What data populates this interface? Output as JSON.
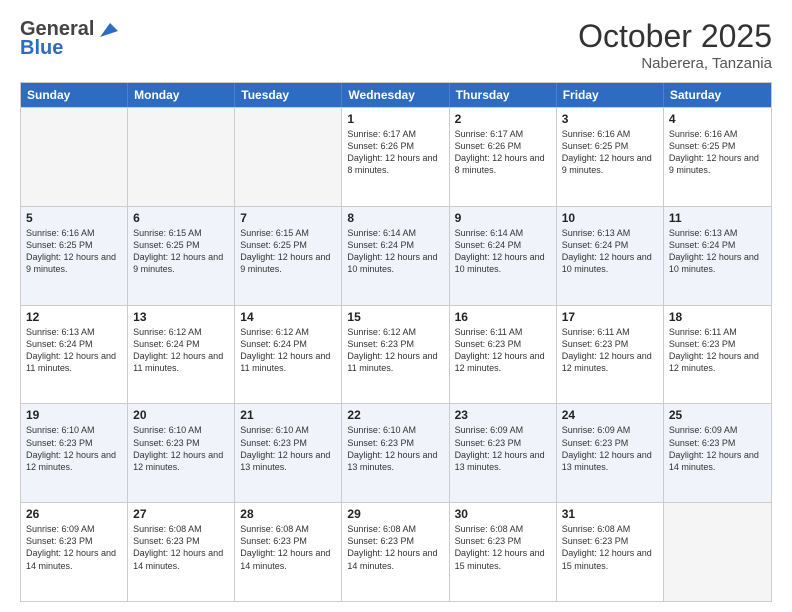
{
  "header": {
    "logo_general": "General",
    "logo_blue": "Blue",
    "month_title": "October 2025",
    "subtitle": "Naberera, Tanzania"
  },
  "days_of_week": [
    "Sunday",
    "Monday",
    "Tuesday",
    "Wednesday",
    "Thursday",
    "Friday",
    "Saturday"
  ],
  "rows": [
    [
      {
        "day": "",
        "sunrise": "",
        "sunset": "",
        "daylight": "",
        "empty": true
      },
      {
        "day": "",
        "sunrise": "",
        "sunset": "",
        "daylight": "",
        "empty": true
      },
      {
        "day": "",
        "sunrise": "",
        "sunset": "",
        "daylight": "",
        "empty": true
      },
      {
        "day": "1",
        "sunrise": "Sunrise: 6:17 AM",
        "sunset": "Sunset: 6:26 PM",
        "daylight": "Daylight: 12 hours and 8 minutes."
      },
      {
        "day": "2",
        "sunrise": "Sunrise: 6:17 AM",
        "sunset": "Sunset: 6:26 PM",
        "daylight": "Daylight: 12 hours and 8 minutes."
      },
      {
        "day": "3",
        "sunrise": "Sunrise: 6:16 AM",
        "sunset": "Sunset: 6:25 PM",
        "daylight": "Daylight: 12 hours and 9 minutes."
      },
      {
        "day": "4",
        "sunrise": "Sunrise: 6:16 AM",
        "sunset": "Sunset: 6:25 PM",
        "daylight": "Daylight: 12 hours and 9 minutes."
      }
    ],
    [
      {
        "day": "5",
        "sunrise": "Sunrise: 6:16 AM",
        "sunset": "Sunset: 6:25 PM",
        "daylight": "Daylight: 12 hours and 9 minutes."
      },
      {
        "day": "6",
        "sunrise": "Sunrise: 6:15 AM",
        "sunset": "Sunset: 6:25 PM",
        "daylight": "Daylight: 12 hours and 9 minutes."
      },
      {
        "day": "7",
        "sunrise": "Sunrise: 6:15 AM",
        "sunset": "Sunset: 6:25 PM",
        "daylight": "Daylight: 12 hours and 9 minutes."
      },
      {
        "day": "8",
        "sunrise": "Sunrise: 6:14 AM",
        "sunset": "Sunset: 6:24 PM",
        "daylight": "Daylight: 12 hours and 10 minutes."
      },
      {
        "day": "9",
        "sunrise": "Sunrise: 6:14 AM",
        "sunset": "Sunset: 6:24 PM",
        "daylight": "Daylight: 12 hours and 10 minutes."
      },
      {
        "day": "10",
        "sunrise": "Sunrise: 6:13 AM",
        "sunset": "Sunset: 6:24 PM",
        "daylight": "Daylight: 12 hours and 10 minutes."
      },
      {
        "day": "11",
        "sunrise": "Sunrise: 6:13 AM",
        "sunset": "Sunset: 6:24 PM",
        "daylight": "Daylight: 12 hours and 10 minutes."
      }
    ],
    [
      {
        "day": "12",
        "sunrise": "Sunrise: 6:13 AM",
        "sunset": "Sunset: 6:24 PM",
        "daylight": "Daylight: 12 hours and 11 minutes."
      },
      {
        "day": "13",
        "sunrise": "Sunrise: 6:12 AM",
        "sunset": "Sunset: 6:24 PM",
        "daylight": "Daylight: 12 hours and 11 minutes."
      },
      {
        "day": "14",
        "sunrise": "Sunrise: 6:12 AM",
        "sunset": "Sunset: 6:24 PM",
        "daylight": "Daylight: 12 hours and 11 minutes."
      },
      {
        "day": "15",
        "sunrise": "Sunrise: 6:12 AM",
        "sunset": "Sunset: 6:23 PM",
        "daylight": "Daylight: 12 hours and 11 minutes."
      },
      {
        "day": "16",
        "sunrise": "Sunrise: 6:11 AM",
        "sunset": "Sunset: 6:23 PM",
        "daylight": "Daylight: 12 hours and 12 minutes."
      },
      {
        "day": "17",
        "sunrise": "Sunrise: 6:11 AM",
        "sunset": "Sunset: 6:23 PM",
        "daylight": "Daylight: 12 hours and 12 minutes."
      },
      {
        "day": "18",
        "sunrise": "Sunrise: 6:11 AM",
        "sunset": "Sunset: 6:23 PM",
        "daylight": "Daylight: 12 hours and 12 minutes."
      }
    ],
    [
      {
        "day": "19",
        "sunrise": "Sunrise: 6:10 AM",
        "sunset": "Sunset: 6:23 PM",
        "daylight": "Daylight: 12 hours and 12 minutes."
      },
      {
        "day": "20",
        "sunrise": "Sunrise: 6:10 AM",
        "sunset": "Sunset: 6:23 PM",
        "daylight": "Daylight: 12 hours and 12 minutes."
      },
      {
        "day": "21",
        "sunrise": "Sunrise: 6:10 AM",
        "sunset": "Sunset: 6:23 PM",
        "daylight": "Daylight: 12 hours and 13 minutes."
      },
      {
        "day": "22",
        "sunrise": "Sunrise: 6:10 AM",
        "sunset": "Sunset: 6:23 PM",
        "daylight": "Daylight: 12 hours and 13 minutes."
      },
      {
        "day": "23",
        "sunrise": "Sunrise: 6:09 AM",
        "sunset": "Sunset: 6:23 PM",
        "daylight": "Daylight: 12 hours and 13 minutes."
      },
      {
        "day": "24",
        "sunrise": "Sunrise: 6:09 AM",
        "sunset": "Sunset: 6:23 PM",
        "daylight": "Daylight: 12 hours and 13 minutes."
      },
      {
        "day": "25",
        "sunrise": "Sunrise: 6:09 AM",
        "sunset": "Sunset: 6:23 PM",
        "daylight": "Daylight: 12 hours and 14 minutes."
      }
    ],
    [
      {
        "day": "26",
        "sunrise": "Sunrise: 6:09 AM",
        "sunset": "Sunset: 6:23 PM",
        "daylight": "Daylight: 12 hours and 14 minutes."
      },
      {
        "day": "27",
        "sunrise": "Sunrise: 6:08 AM",
        "sunset": "Sunset: 6:23 PM",
        "daylight": "Daylight: 12 hours and 14 minutes."
      },
      {
        "day": "28",
        "sunrise": "Sunrise: 6:08 AM",
        "sunset": "Sunset: 6:23 PM",
        "daylight": "Daylight: 12 hours and 14 minutes."
      },
      {
        "day": "29",
        "sunrise": "Sunrise: 6:08 AM",
        "sunset": "Sunset: 6:23 PM",
        "daylight": "Daylight: 12 hours and 14 minutes."
      },
      {
        "day": "30",
        "sunrise": "Sunrise: 6:08 AM",
        "sunset": "Sunset: 6:23 PM",
        "daylight": "Daylight: 12 hours and 15 minutes."
      },
      {
        "day": "31",
        "sunrise": "Sunrise: 6:08 AM",
        "sunset": "Sunset: 6:23 PM",
        "daylight": "Daylight: 12 hours and 15 minutes."
      },
      {
        "day": "",
        "sunrise": "",
        "sunset": "",
        "daylight": "",
        "empty": true
      }
    ]
  ]
}
